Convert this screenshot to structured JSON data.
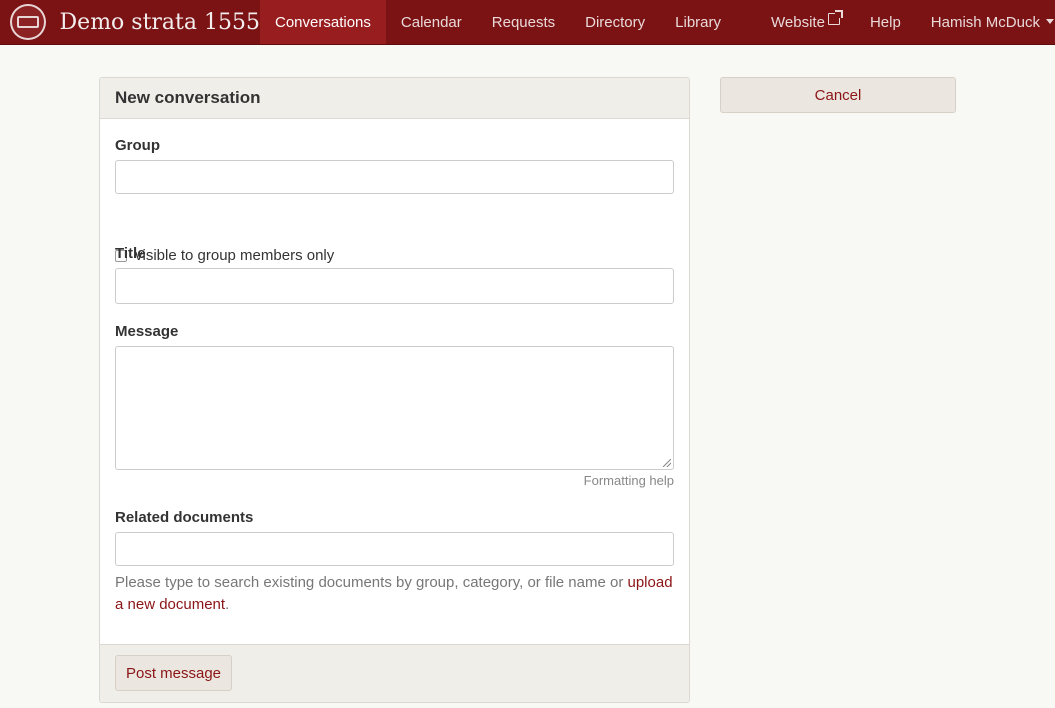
{
  "navbar": {
    "title": "Demo strata 1555",
    "items": [
      {
        "label": "Conversations"
      },
      {
        "label": "Calendar"
      },
      {
        "label": "Requests"
      },
      {
        "label": "Directory"
      },
      {
        "label": "Library"
      },
      {
        "label": "Website"
      },
      {
        "label": "Help"
      }
    ],
    "user_name": "Hamish McDuck"
  },
  "form": {
    "heading": "New conversation",
    "group_label": "Group",
    "group_value": "",
    "visibility_label": "visible to group members only",
    "visibility_checked": false,
    "title_label": "Title",
    "title_value": "",
    "message_label": "Message",
    "message_value": "",
    "formatting_help": "Formatting help",
    "related_label": "Related documents",
    "related_value": "",
    "related_help": "Please type to search existing documents by group, category, or file name or ",
    "upload_link": "upload a new document",
    "related_help_end": ".",
    "submit_label": "Post message"
  },
  "sidebar": {
    "cancel_label": "Cancel"
  },
  "colors": {
    "brand": "#7b1214",
    "active_tab": "#981d1f",
    "link": "#8b1416"
  }
}
